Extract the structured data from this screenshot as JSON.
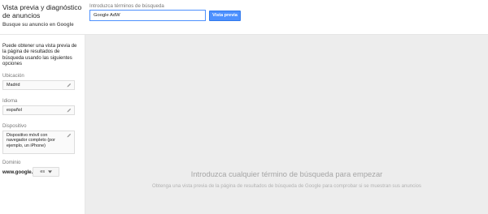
{
  "header": {
    "title": "Vista previa y diagnóstico de anuncios",
    "subtitle": "Busque su anuncio en Google",
    "search_label": "Introduzca términos de búsqueda",
    "search_value": "Google AdW",
    "preview_button": "Vista previa"
  },
  "sidebar": {
    "intro": "Puede obtener una vista previa de la página de resultados de búsqueda usando las siguientes opciones",
    "fields": [
      {
        "label": "Ubicación",
        "value": "Madrid",
        "icon": "pencil-icon"
      },
      {
        "label": "Idioma",
        "value": "español",
        "icon": "pencil-icon"
      },
      {
        "label": "Dispositivo",
        "value": "Dispositivo móvil con navegador completo (por ejemplo, un iPhone)",
        "icon": "pencil-icon"
      }
    ],
    "domain_label": "Dominio",
    "domain_prefix": "www.google.",
    "domain_value": "es",
    "domain_icon": "dropdown-triangle-icon"
  },
  "main": {
    "heading": "Introduzca cualquier término de búsqueda para empezar",
    "subtext": "Obtenga una vista previa de la página de resultados de búsqueda de Google para comprobar si se muestran sus anuncios"
  },
  "colors": {
    "accent": "#4d90fe",
    "canvas": "#ededed",
    "muted_text": "#a5a5a5"
  }
}
